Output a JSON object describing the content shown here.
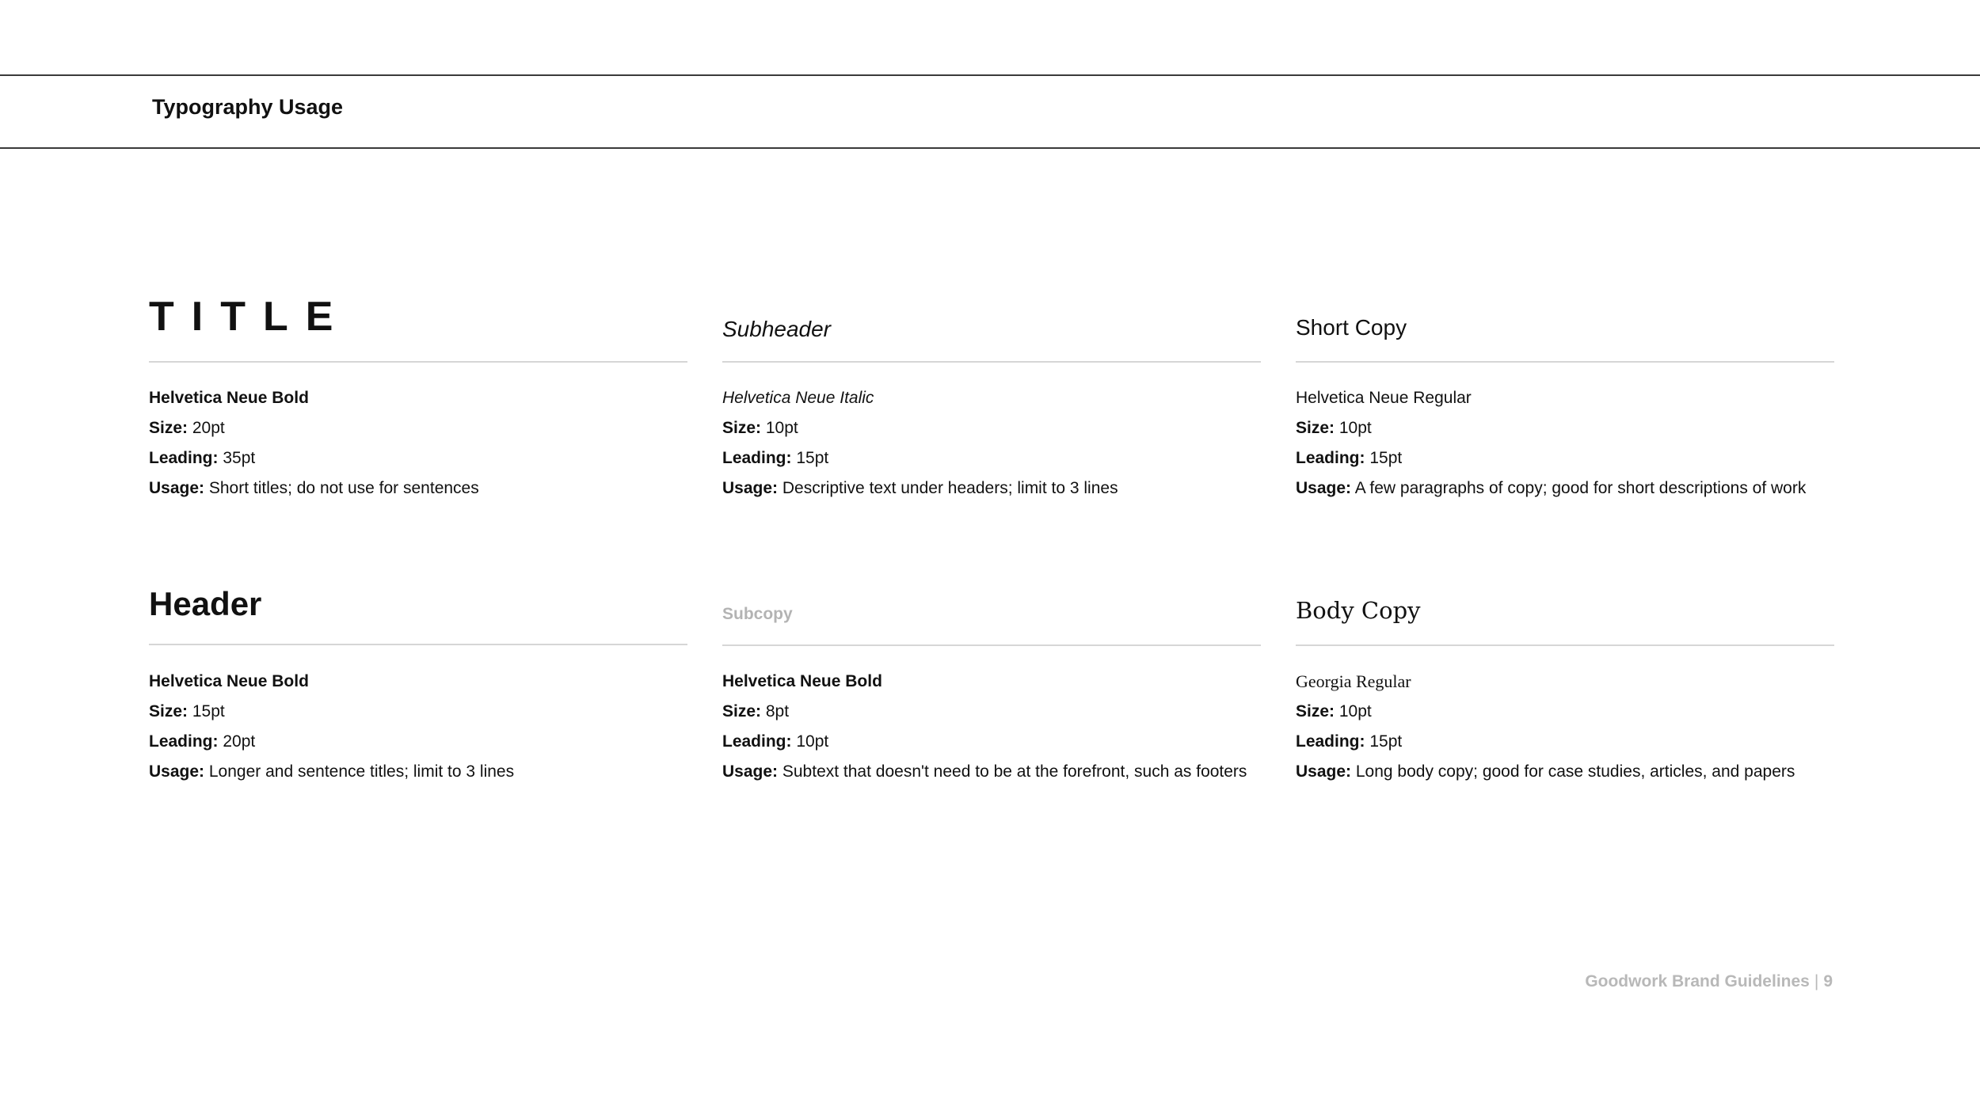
{
  "page": {
    "title": "Typography Usage",
    "footer_text": "Goodwork Brand Guidelines",
    "footer_separator": "|",
    "page_number": "9"
  },
  "labels": {
    "size": "Size:",
    "leading": "Leading:",
    "usage": "Usage:"
  },
  "styles": [
    {
      "sample": "TITLE",
      "font": "Helvetica Neue Bold",
      "size": "20pt",
      "leading": "35pt",
      "usage": "Short titles; do not use for sentences"
    },
    {
      "sample": "Subheader",
      "font": "Helvetica Neue Italic",
      "size": "10pt",
      "leading": "15pt",
      "usage": "Descriptive text under headers; limit to 3 lines"
    },
    {
      "sample": "Short Copy",
      "font": "Helvetica Neue Regular",
      "size": "10pt",
      "leading": "15pt",
      "usage": "A few paragraphs of copy; good for short descriptions of work"
    },
    {
      "sample": "Header",
      "font": "Helvetica Neue Bold",
      "size": "15pt",
      "leading": "20pt",
      "usage": "Longer and sentence titles; limit to 3 lines"
    },
    {
      "sample": "Subcopy",
      "font": "Helvetica Neue Bold",
      "size": "8pt",
      "leading": "10pt",
      "usage": "Subtext that doesn't need to be at the forefront, such as footers"
    },
    {
      "sample": "Body Copy",
      "font": "Georgia Regular",
      "size": "10pt",
      "leading": "15pt",
      "usage": "Long body copy; good for case studies, articles, and papers"
    }
  ],
  "colors": {
    "text": "#111111",
    "muted": "#b3b3b3",
    "divider": "#d6d6d6",
    "rule": "#3a3a3a"
  }
}
